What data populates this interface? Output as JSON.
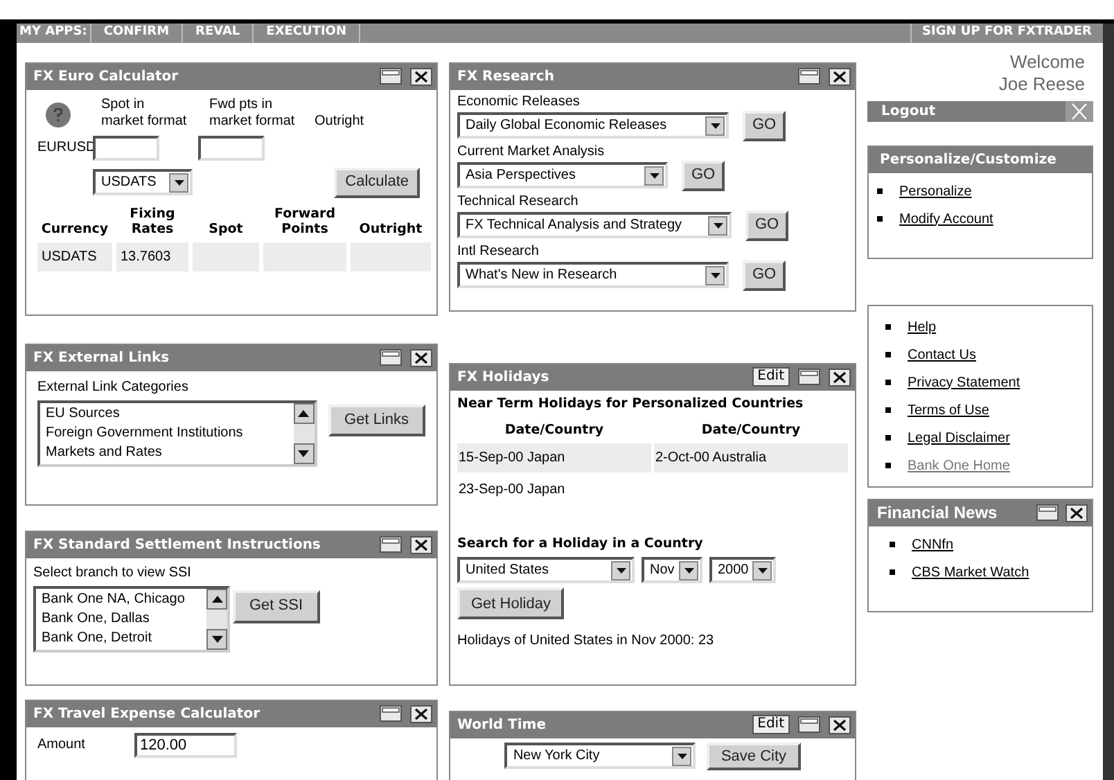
{
  "nav": {
    "label": "MY APPS:",
    "apps": [
      {
        "label": "CONFIRM"
      },
      {
        "label": "REVAL"
      },
      {
        "label": "EXECUTION"
      }
    ],
    "signup": "SIGN UP FOR FXTRADER"
  },
  "euro_calculator": {
    "title": "FX Euro Calculator",
    "spot_label": "Spot in market format",
    "fwd_label": "Fwd pts in market format",
    "outright_label": "Outright",
    "pair": "EURUSD",
    "currency_select": "USDATS",
    "calculate": "Calculate",
    "columns": [
      "Currency",
      "Fixing Rates",
      "Spot",
      "Forward Points",
      "Outright"
    ],
    "rows": [
      {
        "currency": "USDATS",
        "fixing_rate": "13.7603"
      }
    ]
  },
  "external_links": {
    "title": "FX External Links",
    "label": "External Link Categories",
    "options": [
      "EU Sources",
      "Foreign Government Institutions",
      "Markets and Rates"
    ],
    "button": "Get Links"
  },
  "ssi": {
    "title": "FX Standard Settlement Instructions",
    "label": "Select branch to view SSI",
    "options": [
      "Bank One NA, Chicago",
      "Bank One, Dallas",
      "Bank One, Detroit"
    ],
    "button": "Get SSI"
  },
  "travel": {
    "title": "FX Travel Expense Calculator",
    "amount_label": "Amount",
    "amount": "120.00"
  },
  "research": {
    "title": "FX Research",
    "sections": [
      {
        "label": "Economic Releases",
        "value": "Daily Global Economic Releases",
        "button": "GO"
      },
      {
        "label": "Current Market Analysis",
        "value": "Asia Perspectives",
        "button": "GO"
      },
      {
        "label": "Technical Research",
        "value": "FX Technical Analysis and Strategy",
        "button": "GO"
      },
      {
        "label": "Intl Research",
        "value": "What's New in Research",
        "button": "GO"
      }
    ]
  },
  "holidays": {
    "title": "FX Holidays",
    "edit": "Edit",
    "subtitle": "Near Term Holidays for Personalized Countries",
    "columns": [
      "Date/Country",
      "Date/Country"
    ],
    "rows": [
      [
        "15-Sep-00 Japan",
        "2-Oct-00 Australia"
      ],
      [
        "23-Sep-00 Japan"
      ]
    ],
    "search_title": "Search for a Holiday in a Country",
    "country": "United States",
    "month": "Nov",
    "year": "2000",
    "button": "Get Holiday",
    "result": "Holidays of United States in Nov 2000: 23"
  },
  "world_time": {
    "title": "World Time",
    "edit": "Edit",
    "city": "New York City",
    "button": "Save City"
  },
  "welcome": [
    "Welcome",
    "Joe Reese"
  ],
  "logout": "Logout",
  "personalize": {
    "title": "Personalize/Customize",
    "links": [
      {
        "label": "Personalize",
        "visited": false
      },
      {
        "label": "Modify Account",
        "visited": false
      }
    ]
  },
  "help_links": [
    {
      "label": "Help",
      "visited": false
    },
    {
      "label": "Contact Us",
      "visited": false
    },
    {
      "label": "Privacy Statement",
      "visited": false
    },
    {
      "label": "Terms of Use",
      "visited": false
    },
    {
      "label": "Legal Disclaimer",
      "visited": false
    },
    {
      "label": "Bank One Home",
      "visited": true
    }
  ],
  "news": {
    "title": "Financial News",
    "links": [
      {
        "label": "CNNfn",
        "visited": false
      },
      {
        "label": "CBS Market Watch",
        "visited": false
      }
    ]
  }
}
